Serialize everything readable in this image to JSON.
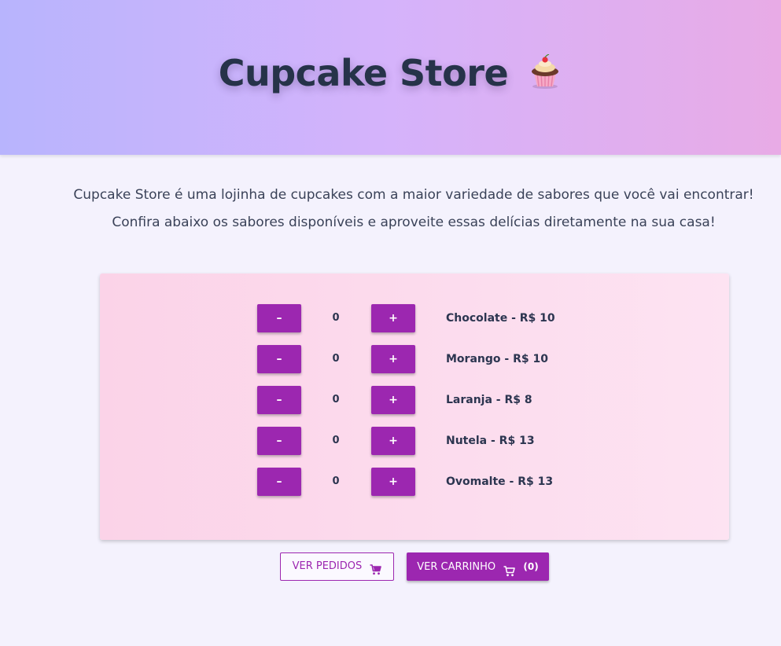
{
  "header": {
    "title": "Cupcake Store",
    "icon": "cupcake-icon"
  },
  "intro": {
    "line1": "Cupcake Store é uma lojinha de cupcakes com a maior variedade de sabores que você vai encontrar!",
    "line2": "Confira abaixo os sabores disponíveis e aproveite essas delícias diretamente na sua casa!"
  },
  "products": {
    "minus_label": "–",
    "plus_label": "+",
    "items": [
      {
        "label": "Chocolate - R$ 10",
        "quantity": "0"
      },
      {
        "label": "Morango - R$ 10",
        "quantity": "0"
      },
      {
        "label": "Laranja - R$ 8",
        "quantity": "0"
      },
      {
        "label": "Nutela - R$ 13",
        "quantity": "0"
      },
      {
        "label": "Ovomalte - R$ 13",
        "quantity": "0"
      }
    ]
  },
  "actions": {
    "orders_label": "VER PEDIDOS",
    "orders_icon": "cart-icon",
    "cart_label": "VER CARRINHO",
    "cart_icon": "cart-icon",
    "cart_count": "(0)"
  },
  "colors": {
    "accent": "#9c27b0",
    "hero_gradient_start": "#b8b4fd",
    "hero_gradient_end": "#e8abe6",
    "card_background": "#fbd3e8",
    "page_background": "#f4f2fd",
    "text": "#2c3550"
  }
}
